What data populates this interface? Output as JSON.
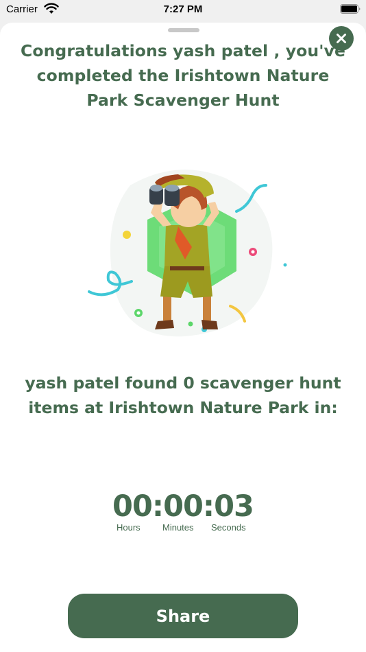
{
  "status_bar": {
    "carrier": "Carrier",
    "time": "7:27 PM"
  },
  "modal": {
    "headline": "Congratulations yash patel , you've completed the Irishtown Nature Park Scavenger Hunt",
    "found_text": "yash patel found 0 scavenger hunt items at Irishtown Nature Park in:",
    "timer": {
      "value": "00:00:03",
      "units": {
        "hours": "Hours",
        "minutes": "Minutes",
        "seconds": "Seconds"
      }
    },
    "share_label": "Share"
  },
  "icons": {
    "close": "close-icon",
    "wifi": "wifi-icon",
    "battery": "battery-icon",
    "illustration": "explorer-with-binoculars-illustration"
  },
  "colors": {
    "primary": "#466b50",
    "accent_green": "#5cd66a",
    "sheet_bg": "#ffffff"
  }
}
